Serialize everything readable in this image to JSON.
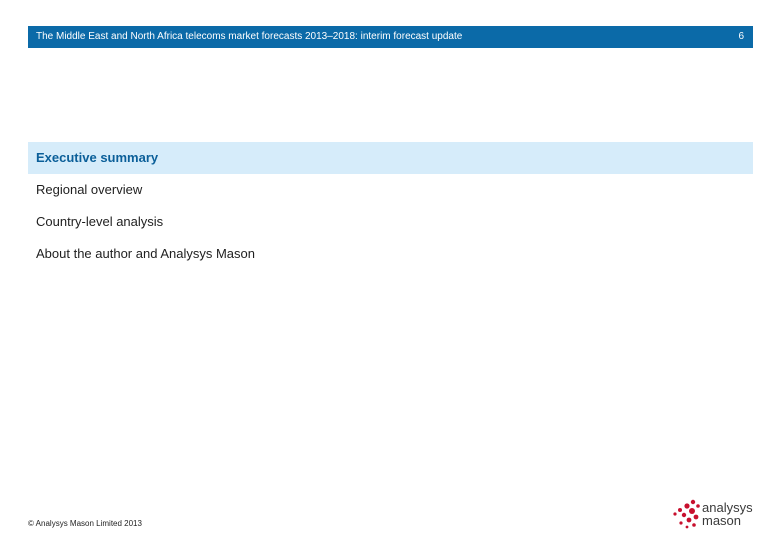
{
  "header": {
    "title": "The Middle East and North Africa telecoms market forecasts 2013–2018: interim forecast update",
    "page_number": "6"
  },
  "toc": {
    "items": [
      {
        "label": "Executive summary",
        "active": true
      },
      {
        "label": "Regional overview",
        "active": false
      },
      {
        "label": "Country-level analysis",
        "active": false
      },
      {
        "label": "About the author and Analysys Mason",
        "active": false
      }
    ]
  },
  "footer": {
    "copyright": "© Analysys Mason Limited 2013"
  },
  "logo": {
    "line1": "analysys",
    "line2": "mason",
    "dot_color": "#c8102e"
  },
  "colors": {
    "header_bg": "#0b6aa8",
    "active_bg": "#d6ecfa",
    "active_text": "#0b5f99"
  }
}
